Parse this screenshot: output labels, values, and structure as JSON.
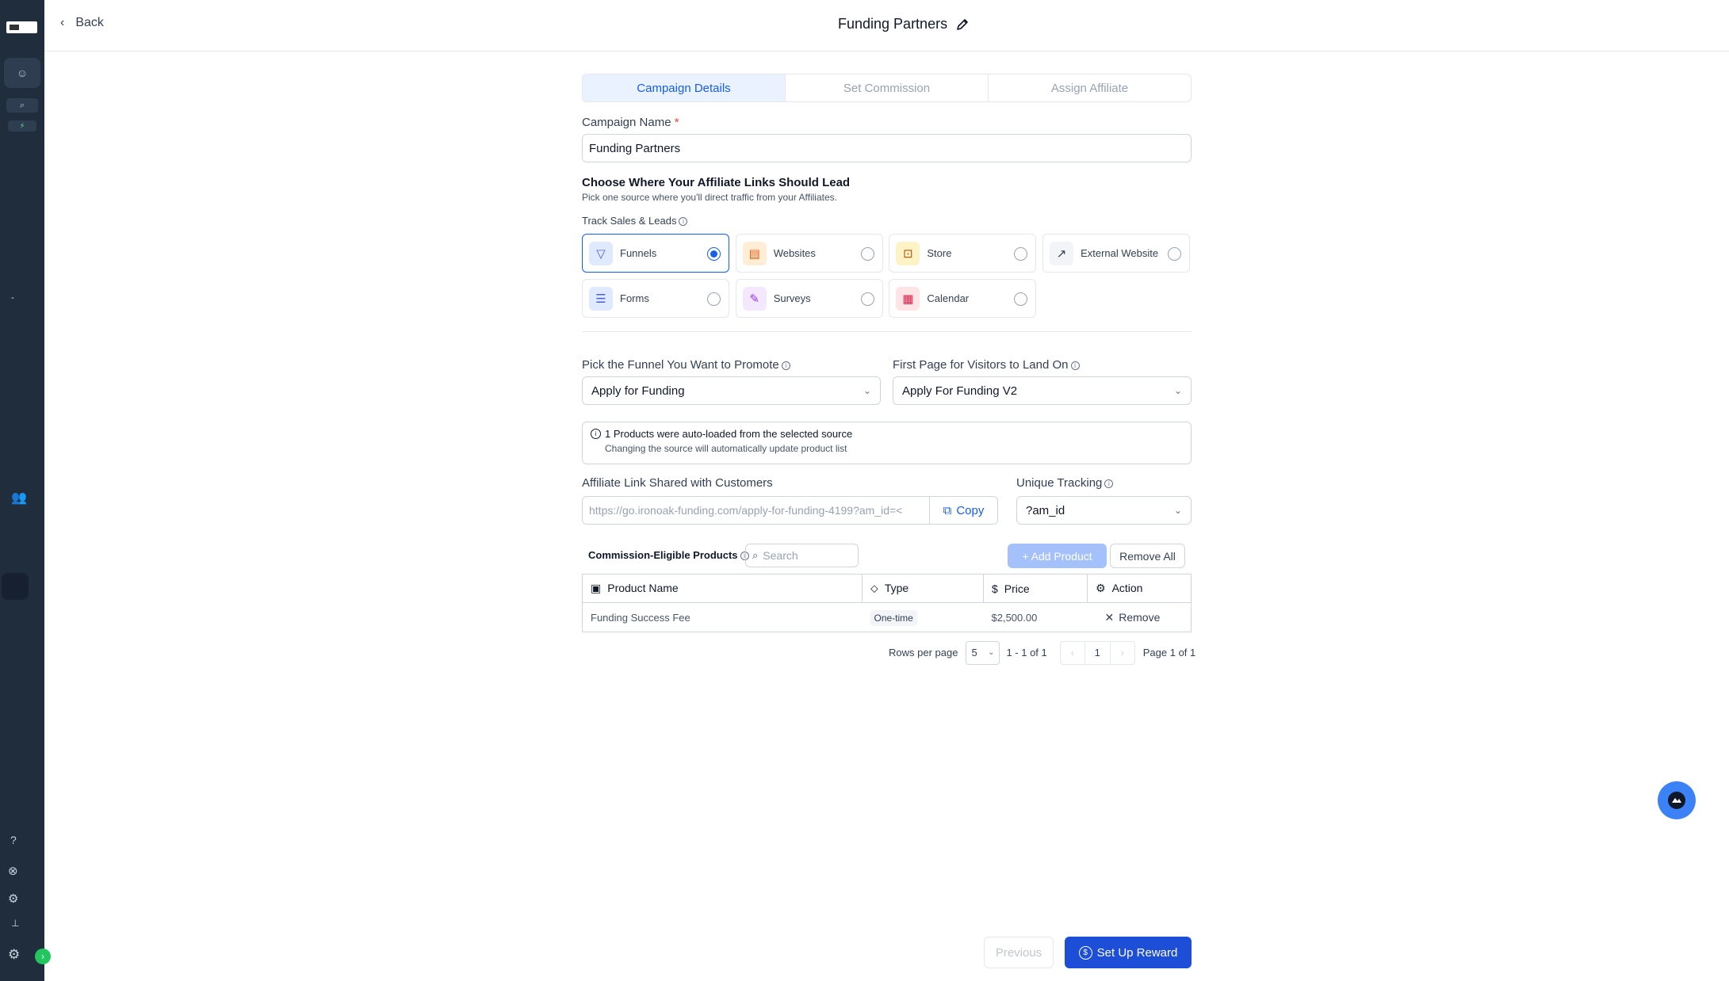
{
  "header": {
    "back_label": "Back",
    "title": "Funding Partners"
  },
  "tabs": [
    {
      "label": "Campaign Details",
      "active": true
    },
    {
      "label": "Set Commission",
      "active": false
    },
    {
      "label": "Assign Affiliate",
      "active": false
    }
  ],
  "campaign_name": {
    "label": "Campaign Name",
    "required_mark": "*",
    "value": "Funding Partners"
  },
  "destination": {
    "heading": "Choose Where Your Affiliate Links Should Lead",
    "subheading": "Pick one source where you'll direct traffic from your Affiliates.",
    "track_label": "Track Sales & Leads",
    "sources": [
      {
        "label": "Funnels",
        "icon": "funnel-icon",
        "color": "#e0eaff",
        "selected": true
      },
      {
        "label": "Websites",
        "icon": "website-icon",
        "color": "#ffedd5",
        "selected": false
      },
      {
        "label": "Store",
        "icon": "store-icon",
        "color": "#fef3c7",
        "selected": false
      },
      {
        "label": "External Website",
        "icon": "external-link-icon",
        "color": "#f2f4f7",
        "selected": false
      },
      {
        "label": "Forms",
        "icon": "form-icon",
        "color": "#e0eaff",
        "selected": false
      },
      {
        "label": "Surveys",
        "icon": "survey-icon",
        "color": "#f3e8ff",
        "selected": false
      },
      {
        "label": "Calendar",
        "icon": "calendar-icon",
        "color": "#ffe4e6",
        "selected": false
      }
    ]
  },
  "funnel_select": {
    "label": "Pick the Funnel You Want to Promote",
    "value": "Apply for Funding"
  },
  "landing_select": {
    "label": "First Page for Visitors to Land On",
    "value": "Apply For Funding V2"
  },
  "notice": {
    "title": "1 Products were auto-loaded from the selected source",
    "body": "Changing the source will automatically update product list"
  },
  "affiliate_link": {
    "label": "Affiliate Link Shared with Customers",
    "value": "https://go.ironoak-funding.com/apply-for-funding-4199?am_id=<",
    "copy_label": "Copy"
  },
  "unique_tracking": {
    "label": "Unique Tracking",
    "value": "?am_id"
  },
  "products": {
    "label": "Commission-Eligible Products",
    "search_placeholder": "Search",
    "add_label": "+ Add Product",
    "remove_all_label": "Remove All",
    "columns": [
      "Product Name",
      "Type",
      "Price",
      "Action"
    ],
    "rows": [
      {
        "name": "Funding Success Fee",
        "type": "One-time",
        "price": "$2,500.00",
        "action": "Remove"
      }
    ]
  },
  "pagination": {
    "rows_per_page_label": "Rows per page",
    "rows_per_page": "5",
    "range": "1 - 1 of 1",
    "current_page": "1",
    "page_info": "Page 1 of 1"
  },
  "footer": {
    "previous_label": "Previous",
    "next_label": "Set Up Reward"
  },
  "colors": {
    "primary": "#155eef",
    "sidebar": "#1f2d3d",
    "cta": "#1d4ed8"
  }
}
